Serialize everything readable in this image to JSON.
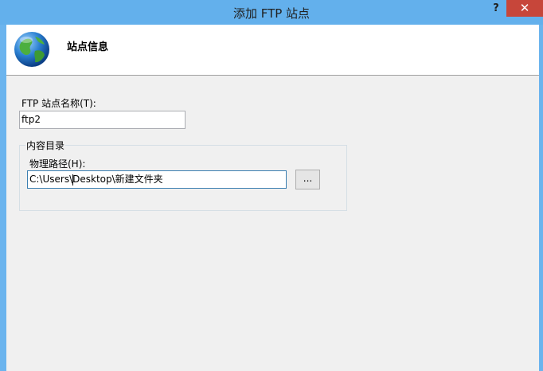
{
  "window": {
    "title": "添加 FTP 站点",
    "help_label": "?",
    "close_label": "✕"
  },
  "header": {
    "title": "站点信息",
    "icon": "globe-icon"
  },
  "site_name": {
    "label": "FTP 站点名称(T):",
    "value": "ftp2"
  },
  "content_directory": {
    "group_label": "内容目录",
    "path_label": "物理路径(H):",
    "path_value_before_caret": "C:\\Users\\",
    "path_value_after_caret": "Desktop\\新建文件夹",
    "browse_label": "..."
  },
  "colors": {
    "titlebar": "#63b0ec",
    "close_button": "#c7463a",
    "dialog_bg": "#f0f0f0"
  }
}
